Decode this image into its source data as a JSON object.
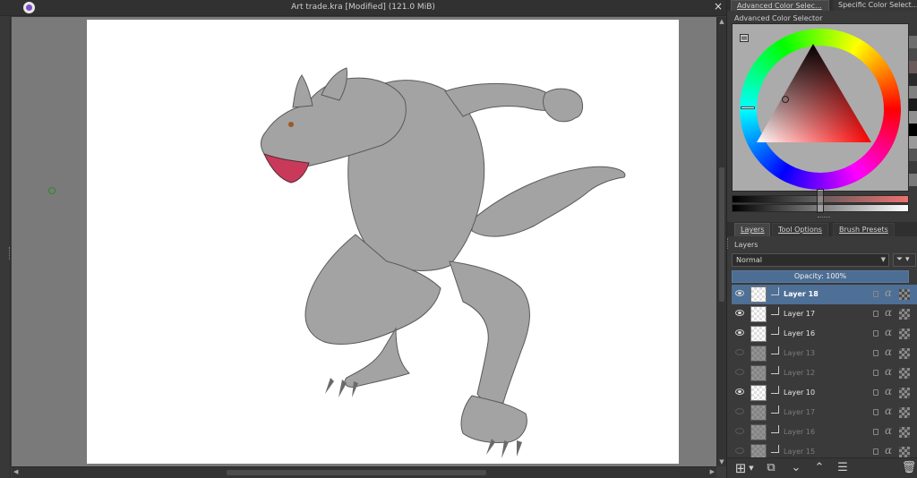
{
  "window": {
    "title": "Art trade.kra [Modified]  (121.0 MiB)",
    "close_glyph": "×"
  },
  "color_docker": {
    "tabs": [
      "Advanced Color Selec...",
      "Specific Color Select..."
    ],
    "title": "Advanced Color Selector",
    "settings_icon": "list-settings-icon",
    "selected_hue_color": "#ff0000",
    "swatches": [
      "#3a3a3a",
      "#6e6e6e",
      "#4a4a4a",
      "#6a5a5a",
      "#2a2a2a",
      "#808080",
      "#1a1a1a",
      "#909090",
      "#000000",
      "#9a9a9a",
      "#555555",
      "#3a3a3a",
      "#7a7a7a"
    ]
  },
  "layers_docker": {
    "tabs": [
      "Layers",
      "Tool Options",
      "Brush Presets"
    ],
    "title": "Layers",
    "blend_mode": "Normal",
    "filter_icon": "filter-icon",
    "opacity_label": "Opacity:  100%",
    "layers": [
      {
        "name": "Layer 18",
        "visible": true,
        "selected": true
      },
      {
        "name": "Layer 17",
        "visible": true,
        "selected": false
      },
      {
        "name": "Layer 16",
        "visible": true,
        "selected": false
      },
      {
        "name": "Layer 13",
        "visible": false,
        "selected": false
      },
      {
        "name": "Layer 12",
        "visible": false,
        "selected": false
      },
      {
        "name": "Layer 10",
        "visible": true,
        "selected": false
      },
      {
        "name": "Layer 17",
        "visible": false,
        "selected": false
      },
      {
        "name": "Layer 16",
        "visible": false,
        "selected": false
      },
      {
        "name": "Layer 15",
        "visible": false,
        "selected": false
      }
    ],
    "toolbar": [
      "add-layer-icon",
      "duplicate-layer-icon",
      "move-down-icon",
      "move-up-icon",
      "layer-properties-icon",
      "delete-layer-icon"
    ]
  },
  "canvas": {
    "paper_color": "#ffffff",
    "background_color": "#7a7a7a"
  }
}
